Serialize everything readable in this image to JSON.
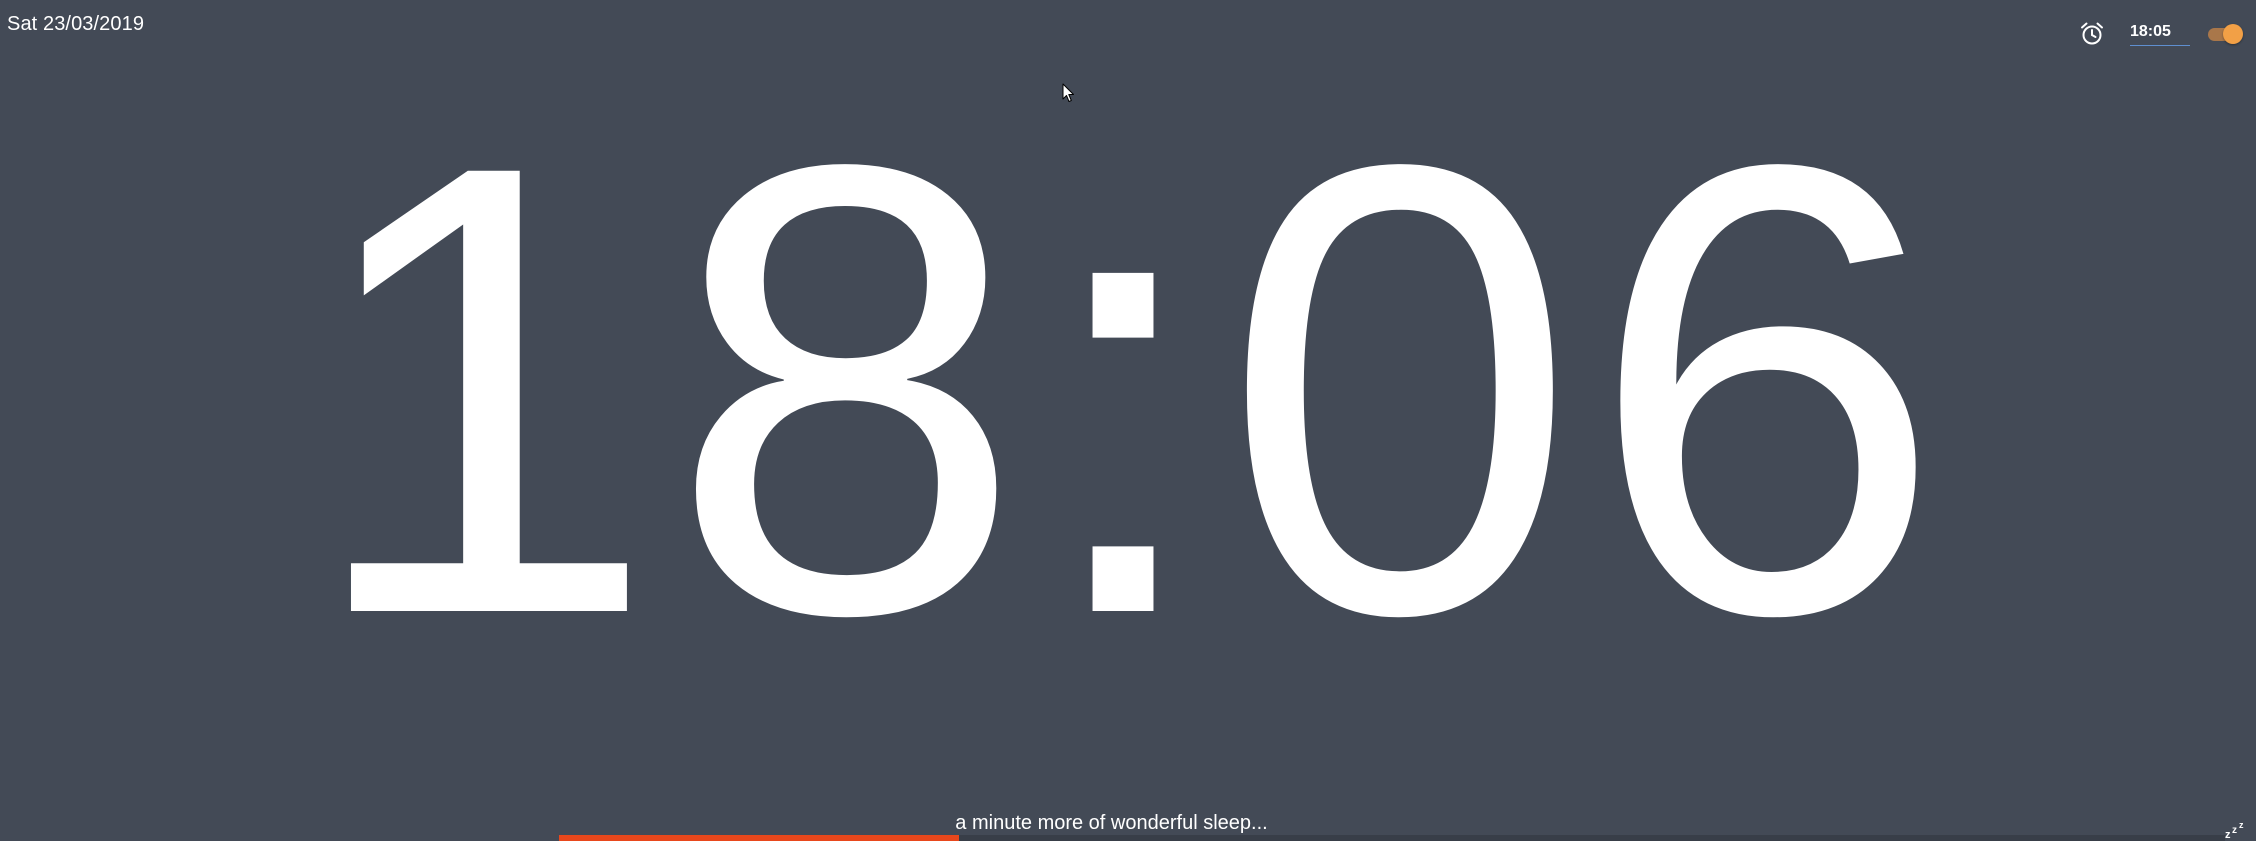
{
  "header": {
    "date": "Sat 23/03/2019"
  },
  "alarm": {
    "icon": "alarm-clock-icon",
    "time": "18:05",
    "enabled": true,
    "toggle_color": "#f2a046"
  },
  "clock": {
    "time": "18:06"
  },
  "snooze": {
    "message": "a minute more of wonderful sleep...",
    "progress_fraction": 0.24,
    "bar_color": "#e8471c",
    "icon": "zzz-icon"
  },
  "theme": {
    "background": "#434a56",
    "text": "#ffffff"
  }
}
